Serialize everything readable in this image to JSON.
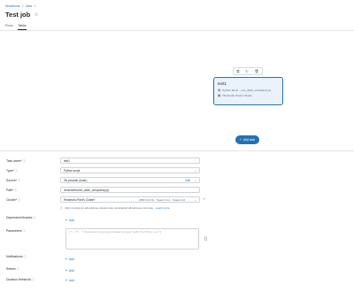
{
  "breadcrumb": {
    "items": [
      "Workflows",
      "Jobs"
    ],
    "separator": ">"
  },
  "page": {
    "title": "Test job"
  },
  "tabs": [
    {
      "label": "Runs"
    },
    {
      "label": "Tasks"
    }
  ],
  "node": {
    "title": "test1",
    "source_line": "Python file at ...ces_dash_occupancy.py",
    "cluster_line": "Himanshu Pant's Cluster"
  },
  "add_task": {
    "label": "Add task"
  },
  "form": {
    "task_name": {
      "label": "Task name*",
      "value": "test1"
    },
    "type": {
      "label": "Type*",
      "value": "Python script"
    },
    "source": {
      "label": "Source*",
      "value": "Git provider (main)",
      "edit_label": "Edit"
    },
    "path": {
      "label": "Path*",
      "value": "/bronze/bronze_dash_occupancy.py"
    },
    "cluster": {
      "label": "Cluster*",
      "value": "Himanshu Pant's Cluster",
      "spec": "DBR 13.3 lts · Spark 3.4.1 · Scala 2.12"
    },
    "cluster_hint": {
      "text": "Jobs running on all-purpose clusters are considered all-purpose compute.",
      "link": "Learn more"
    },
    "dependent_libraries": {
      "label": "Dependent libraries",
      "add": "Add"
    },
    "parameters": {
      "label": "Parameters",
      "placeholder": "[\"--f\", \"/Volumes/catalog/schema/volume/path/to/file.csv\"]"
    },
    "notifications": {
      "label": "Notifications",
      "add": "Add"
    },
    "retries": {
      "label": "Retries",
      "add": "Add"
    },
    "duration_threshold": {
      "label": "Duration threshold",
      "add": "Add"
    }
  },
  "colors": {
    "accent": "#2272b4",
    "node_bg": "#e9f2fb",
    "border": "#cfd3d7"
  }
}
